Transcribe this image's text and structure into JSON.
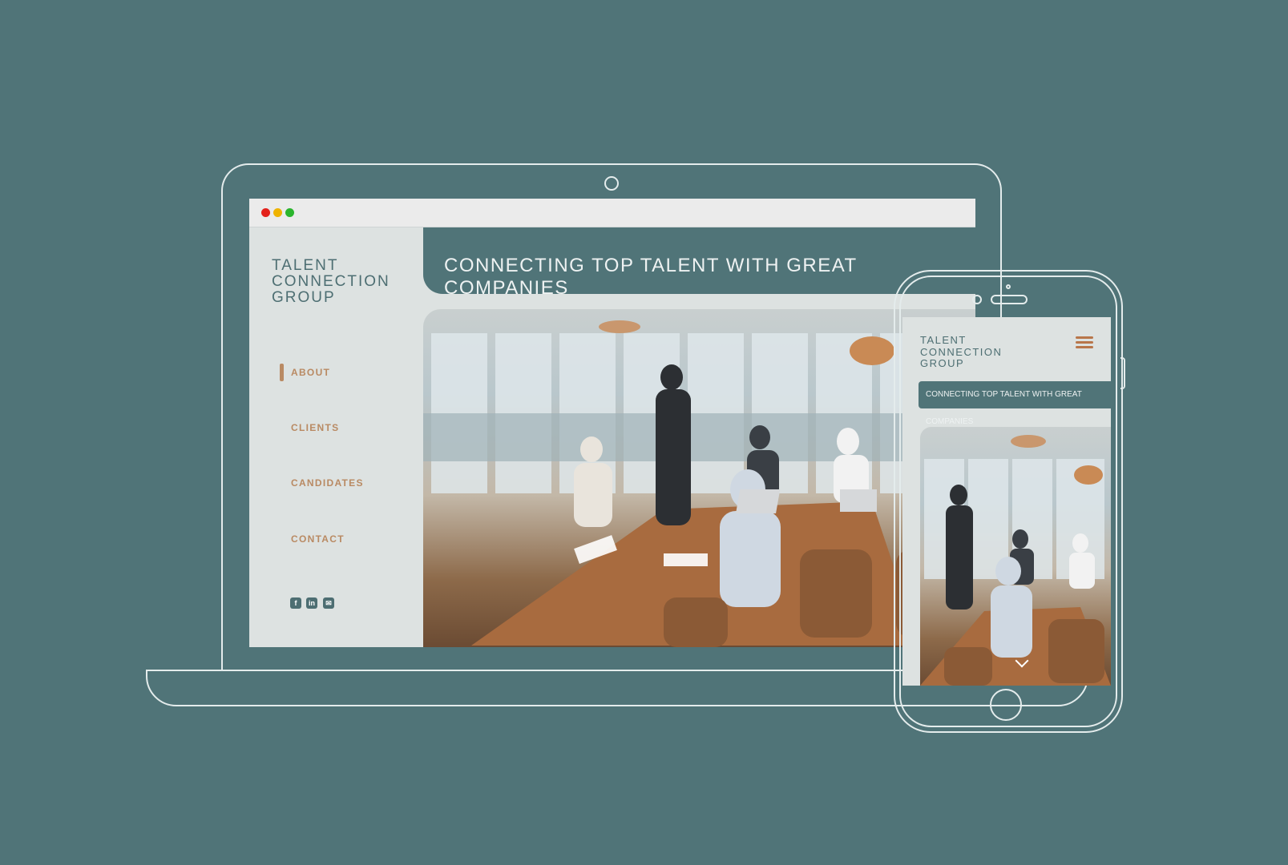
{
  "brand": {
    "name": "TALENT\nCONNECTION\nGROUP"
  },
  "hero": {
    "title": "CONNECTING TOP TALENT WITH GREAT COMPANIES"
  },
  "nav": {
    "items": [
      {
        "label": "ABOUT",
        "active": true
      },
      {
        "label": "CLIENTS",
        "active": false
      },
      {
        "label": "CANDIDATES",
        "active": false
      },
      {
        "label": "CONTACT",
        "active": false
      }
    ]
  },
  "social": {
    "facebook": "f",
    "linkedin": "in",
    "email": "✉"
  },
  "colors": {
    "background": "#507478",
    "panel": "#dde2e1",
    "accent": "#b98a63",
    "brand_text": "#4d6e72"
  },
  "icons": {
    "window_controls": [
      "close-dot",
      "minimize-dot",
      "maximize-dot"
    ],
    "phone_menu": "hamburger-icon",
    "scroll": "chevron-down-icon"
  }
}
